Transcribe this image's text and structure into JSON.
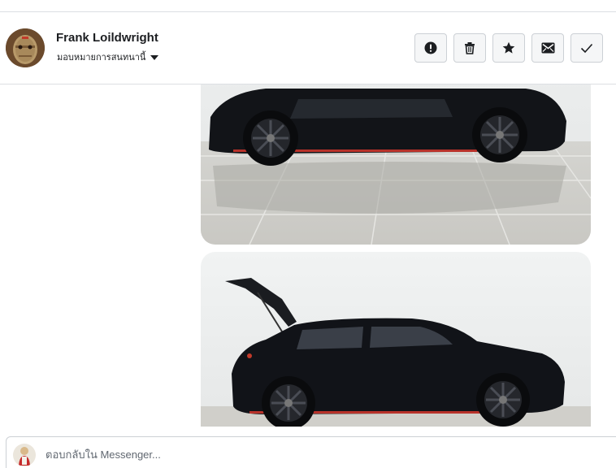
{
  "conversation": {
    "contact_name": "Frank Loildwright",
    "assign_label": "มอบหมายการสนทนานี้"
  },
  "toolbar": {
    "buttons": [
      {
        "icon": "alert-icon"
      },
      {
        "icon": "trash-icon"
      },
      {
        "icon": "star-icon"
      },
      {
        "icon": "envelope-icon"
      },
      {
        "icon": "checkmark-icon"
      }
    ]
  },
  "messages": [
    {
      "type": "photo",
      "subject": "black hatchback side view"
    },
    {
      "type": "photo",
      "subject": "black hatchback with open tailgate"
    }
  ],
  "composer": {
    "placeholder": "ตอบกลับใน Messenger..."
  }
}
